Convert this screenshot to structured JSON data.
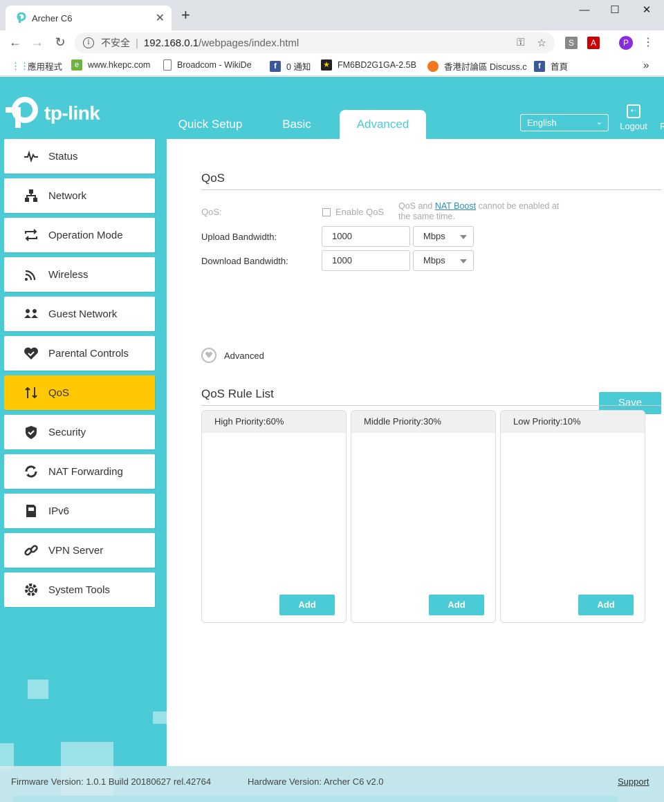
{
  "browser": {
    "tab_title": "Archer C6",
    "omnibox": {
      "security": "不安全",
      "host": "192.168.0.1",
      "path": "/webpages/index.html"
    },
    "bookmarks": [
      {
        "label": "應用程式",
        "icon": "apps-icon"
      },
      {
        "label": "www.hkepc.com",
        "icon": "hkepc-icon"
      },
      {
        "label": "Broadcom - WikiDe",
        "icon": "page-icon"
      },
      {
        "label": "0 通知",
        "icon": "facebook-icon"
      },
      {
        "label": "FM6BD2G1GA-2.5B",
        "icon": "bookmark-icon"
      },
      {
        "label": "香港討論區 Discuss.c",
        "icon": "discuss-icon"
      },
      {
        "label": "首頁",
        "icon": "facebook-icon"
      }
    ],
    "more_label": "»"
  },
  "router": {
    "logo_text": "tp-link",
    "tabs": [
      "Quick Setup",
      "Basic",
      "Advanced"
    ],
    "active_tab": "Advanced",
    "language": "English",
    "logout_label": "Logout",
    "trailing_text": "R",
    "menu": [
      {
        "label": "Status",
        "icon": "status-icon"
      },
      {
        "label": "Network",
        "icon": "network-icon"
      },
      {
        "label": "Operation Mode",
        "icon": "operation-mode-icon"
      },
      {
        "label": "Wireless",
        "icon": "wireless-icon"
      },
      {
        "label": "Guest Network",
        "icon": "guest-network-icon"
      },
      {
        "label": "Parental Controls",
        "icon": "parental-controls-icon"
      },
      {
        "label": "QoS",
        "icon": "qos-icon"
      },
      {
        "label": "Security",
        "icon": "security-icon"
      },
      {
        "label": "NAT Forwarding",
        "icon": "nat-forwarding-icon"
      },
      {
        "label": "IPv6",
        "icon": "ipv6-icon"
      },
      {
        "label": "VPN Server",
        "icon": "vpn-server-icon"
      },
      {
        "label": "System Tools",
        "icon": "system-tools-icon"
      }
    ],
    "active_menu": "QoS",
    "qos": {
      "title": "QoS",
      "qos_label": "QoS:",
      "enable_label": "Enable QoS",
      "enable_checked": false,
      "note_prefix": "QoS and ",
      "note_link": "NAT Boost",
      "note_suffix": " cannot be enabled at the same time.",
      "upload_label": "Upload Bandwidth:",
      "upload_value": "1000",
      "upload_unit": "Mbps",
      "download_label": "Download Bandwidth:",
      "download_value": "1000",
      "download_unit": "Mbps",
      "advanced_label": "Advanced",
      "save_label": "Save"
    },
    "rule_list": {
      "title": "QoS Rule List",
      "columns": [
        {
          "header": "High Priority:60%",
          "add_label": "Add"
        },
        {
          "header": "Middle Priority:30%",
          "add_label": "Add"
        },
        {
          "header": "Low Priority:10%",
          "add_label": "Add"
        }
      ]
    },
    "footer": {
      "firmware": "Firmware Version: 1.0.1 Build 20180627 rel.42764",
      "hardware": "Hardware Version: Archer C6 v2.0",
      "support": "Support"
    },
    "colors": {
      "accent": "#4acbd6",
      "active_menu": "#ffc800",
      "link": "#2a8fb8"
    }
  }
}
